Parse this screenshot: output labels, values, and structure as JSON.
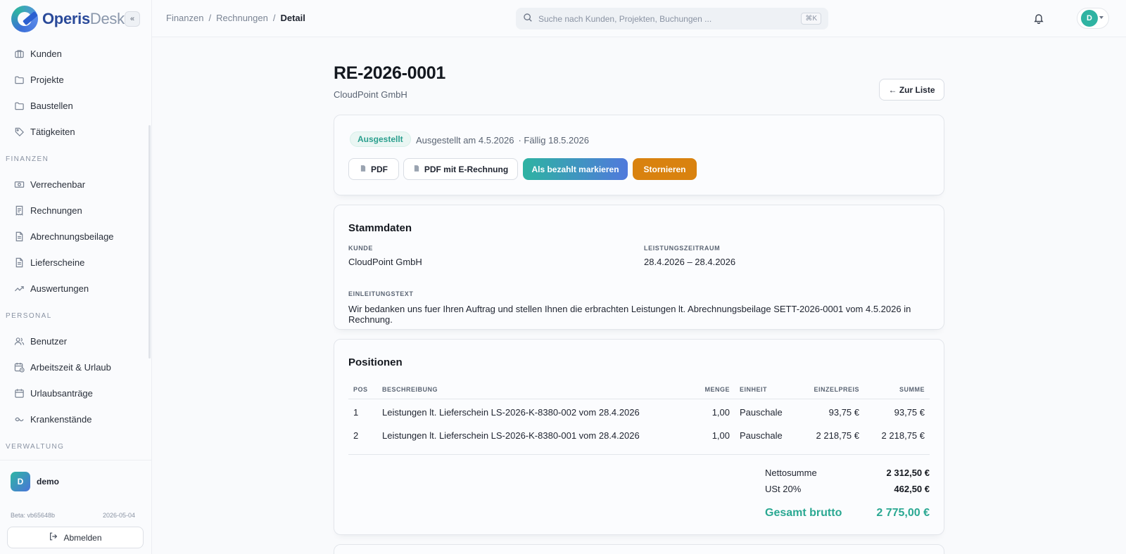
{
  "brand": {
    "part1": "Operis",
    "part2": "Desk"
  },
  "sidebar": {
    "collapse_label": "«",
    "items": [
      {
        "label": "Kunden",
        "icon": "briefcase-icon"
      },
      {
        "label": "Projekte",
        "icon": "folder-icon"
      },
      {
        "label": "Baustellen",
        "icon": "folder-icon"
      },
      {
        "label": "Tätigkeiten",
        "icon": "tag-icon"
      }
    ],
    "section_finanzen": "FINANZEN",
    "finanzen_items": [
      {
        "label": "Verrechenbar",
        "icon": "money-icon"
      },
      {
        "label": "Rechnungen",
        "icon": "receipt-icon"
      },
      {
        "label": "Abrechnungsbeilage",
        "icon": "document-icon"
      },
      {
        "label": "Lieferscheine",
        "icon": "document-icon"
      },
      {
        "label": "Auswertungen",
        "icon": "trend-icon"
      }
    ],
    "section_personal": "PERSONAL",
    "personal_items": [
      {
        "label": "Benutzer",
        "icon": "users-icon"
      },
      {
        "label": "Arbeitszeit & Urlaub",
        "icon": "calendar-clock-icon"
      },
      {
        "label": "Urlaubsanträge",
        "icon": "calendar-icon"
      },
      {
        "label": "Krankenstände",
        "icon": "bandage-icon"
      }
    ],
    "section_verwaltung": "VERWALTUNG",
    "user": {
      "initial": "D",
      "name": "demo"
    },
    "beta": "Beta: vb65648b",
    "beta_date": "2026-05-04",
    "logout": "Abmelden"
  },
  "topbar": {
    "crumbs": [
      "Finanzen",
      "Rechnungen",
      "Detail"
    ],
    "search_placeholder": "Suche nach Kunden, Projekten, Buchungen ...",
    "search_kbd": "⌘K",
    "avatar_initial": "D"
  },
  "invoice": {
    "number": "RE-2026-0001",
    "customer": "CloudPoint GmbH",
    "back_label": "← Zur Liste",
    "status": "Ausgestellt",
    "issued": "Ausgestellt am 4.5.2026",
    "due": "· Fällig 18.5.2026",
    "actions": {
      "pdf": "PDF",
      "pdf_erechnung": "PDF mit E-Rechnung",
      "mark_paid": "Als bezahlt markieren",
      "cancel": "Stornieren"
    },
    "accent_colors": {
      "status": "#2a9f8e",
      "cancel": "#d9820f",
      "gross": "#2aa892"
    }
  },
  "stammdaten": {
    "title": "Stammdaten",
    "kunde_label": "KUNDE",
    "kunde": "CloudPoint GmbH",
    "zeitraum_label": "LEISTUNGSZEITRAUM",
    "zeitraum": "28.4.2026 – 28.4.2026",
    "einleitung_label": "EINLEITUNGSTEXT",
    "einleitung": "Wir bedanken uns fuer Ihren Auftrag und stellen Ihnen die erbrachten Leistungen lt. Abrechnungsbeilage SETT-2026-0001 vom 4.5.2026 in Rechnung."
  },
  "positionen": {
    "title": "Positionen",
    "headers": [
      "POS",
      "BESCHREIBUNG",
      "MENGE",
      "EINHEIT",
      "EINZELPREIS",
      "SUMME"
    ],
    "rows": [
      [
        "1",
        "Leistungen lt. Lieferschein LS-2026-K-8380-002 vom 28.4.2026",
        "1,00",
        "Pauschale",
        "93,75 €",
        "93,75 €"
      ],
      [
        "2",
        "Leistungen lt. Lieferschein LS-2026-K-8380-001 vom 28.4.2026",
        "1,00",
        "Pauschale",
        "2 218,75 €",
        "2 218,75 €"
      ]
    ],
    "netto_label": "Nettosumme",
    "netto": "2 312,50 €",
    "ust_label": "USt 20%",
    "ust": "462,50 €",
    "brutto_label": "Gesamt brutto",
    "brutto": "2 775,00 €"
  }
}
